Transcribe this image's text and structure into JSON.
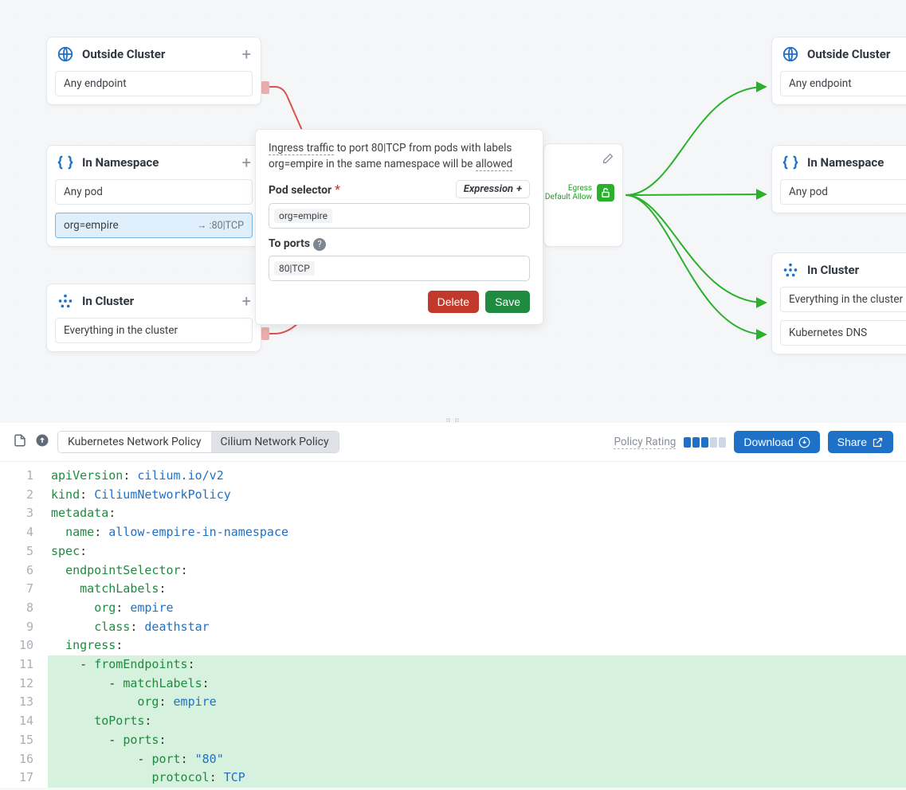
{
  "canvas": {
    "left_nodes": {
      "outside": {
        "title": "Outside Cluster",
        "rows": [
          "Any endpoint"
        ]
      },
      "namespace": {
        "title": "In Namespace",
        "rows": [
          {
            "label": "Any pod"
          },
          {
            "label": "org=empire",
            "right": "→ :80|TCP",
            "selected": true
          }
        ]
      },
      "cluster": {
        "title": "In Cluster",
        "rows": [
          "Everything in the cluster"
        ]
      }
    },
    "right_nodes": {
      "outside": {
        "title": "Outside Cluster",
        "rows": [
          "Any endpoint"
        ]
      },
      "namespace": {
        "title": "In Namespace",
        "rows": [
          "Any pod"
        ]
      },
      "cluster": {
        "title": "In Cluster",
        "rows": [
          "Everything in the cluster",
          "Kubernetes DNS"
        ]
      }
    },
    "center": {
      "egress_label_1": "Egress",
      "egress_label_2": "Default Allow"
    }
  },
  "popup": {
    "description_html": "Ingress traffic to port 80|TCP from pods with labels org=empire in the same namespace will be allowed",
    "desc_parts": {
      "p1": "Ingress traffic",
      "p2": " to port 80|TCP from pods with labels org=empire in the same namespace will be ",
      "p3": "allowed"
    },
    "pod_selector_label": "Pod selector",
    "expression_btn": "Expression",
    "pod_selector_value": "org=empire",
    "to_ports_label": "To ports",
    "to_ports_value": "80|TCP",
    "delete_btn": "Delete",
    "save_btn": "Save"
  },
  "toolbar": {
    "tab1": "Kubernetes Network Policy",
    "tab2": "Cilium Network Policy",
    "rating_label": "Policy Rating",
    "download": "Download",
    "share": "Share"
  },
  "code": {
    "lines": [
      {
        "n": 1,
        "hl": false,
        "tokens": [
          [
            "k",
            "apiVersion"
          ],
          [
            "p",
            ": "
          ],
          [
            "s",
            "cilium.io/v2"
          ]
        ]
      },
      {
        "n": 2,
        "hl": false,
        "tokens": [
          [
            "k",
            "kind"
          ],
          [
            "p",
            ": "
          ],
          [
            "s",
            "CiliumNetworkPolicy"
          ]
        ]
      },
      {
        "n": 3,
        "hl": false,
        "tokens": [
          [
            "k",
            "metadata"
          ],
          [
            "p",
            ":"
          ]
        ]
      },
      {
        "n": 4,
        "hl": false,
        "tokens": [
          [
            "p",
            "  "
          ],
          [
            "k",
            "name"
          ],
          [
            "p",
            ": "
          ],
          [
            "s",
            "allow-empire-in-namespace"
          ]
        ]
      },
      {
        "n": 5,
        "hl": false,
        "tokens": [
          [
            "k",
            "spec"
          ],
          [
            "p",
            ":"
          ]
        ]
      },
      {
        "n": 6,
        "hl": false,
        "tokens": [
          [
            "p",
            "  "
          ],
          [
            "k",
            "endpointSelector"
          ],
          [
            "p",
            ":"
          ]
        ]
      },
      {
        "n": 7,
        "hl": false,
        "tokens": [
          [
            "p",
            "    "
          ],
          [
            "k",
            "matchLabels"
          ],
          [
            "p",
            ":"
          ]
        ]
      },
      {
        "n": 8,
        "hl": false,
        "tokens": [
          [
            "p",
            "      "
          ],
          [
            "k",
            "org"
          ],
          [
            "p",
            ": "
          ],
          [
            "s",
            "empire"
          ]
        ]
      },
      {
        "n": 9,
        "hl": false,
        "tokens": [
          [
            "p",
            "      "
          ],
          [
            "k",
            "class"
          ],
          [
            "p",
            ": "
          ],
          [
            "s",
            "deathstar"
          ]
        ]
      },
      {
        "n": 10,
        "hl": false,
        "tokens": [
          [
            "p",
            "  "
          ],
          [
            "k",
            "ingress"
          ],
          [
            "p",
            ":"
          ]
        ]
      },
      {
        "n": 11,
        "hl": true,
        "tokens": [
          [
            "p",
            "    - "
          ],
          [
            "k",
            "fromEndpoints"
          ],
          [
            "p",
            ":"
          ]
        ]
      },
      {
        "n": 12,
        "hl": true,
        "tokens": [
          [
            "p",
            "        - "
          ],
          [
            "k",
            "matchLabels"
          ],
          [
            "p",
            ":"
          ]
        ]
      },
      {
        "n": 13,
        "hl": true,
        "tokens": [
          [
            "p",
            "            "
          ],
          [
            "k",
            "org"
          ],
          [
            "p",
            ": "
          ],
          [
            "s",
            "empire"
          ]
        ]
      },
      {
        "n": 14,
        "hl": true,
        "tokens": [
          [
            "p",
            "      "
          ],
          [
            "k",
            "toPorts"
          ],
          [
            "p",
            ":"
          ]
        ]
      },
      {
        "n": 15,
        "hl": true,
        "tokens": [
          [
            "p",
            "        - "
          ],
          [
            "k",
            "ports"
          ],
          [
            "p",
            ":"
          ]
        ]
      },
      {
        "n": 16,
        "hl": true,
        "tokens": [
          [
            "p",
            "            - "
          ],
          [
            "k",
            "port"
          ],
          [
            "p",
            ": "
          ],
          [
            "s",
            "\"80\""
          ]
        ]
      },
      {
        "n": 17,
        "hl": true,
        "tokens": [
          [
            "p",
            "              "
          ],
          [
            "k",
            "protocol"
          ],
          [
            "p",
            ": "
          ],
          [
            "s",
            "TCP"
          ]
        ]
      }
    ]
  }
}
